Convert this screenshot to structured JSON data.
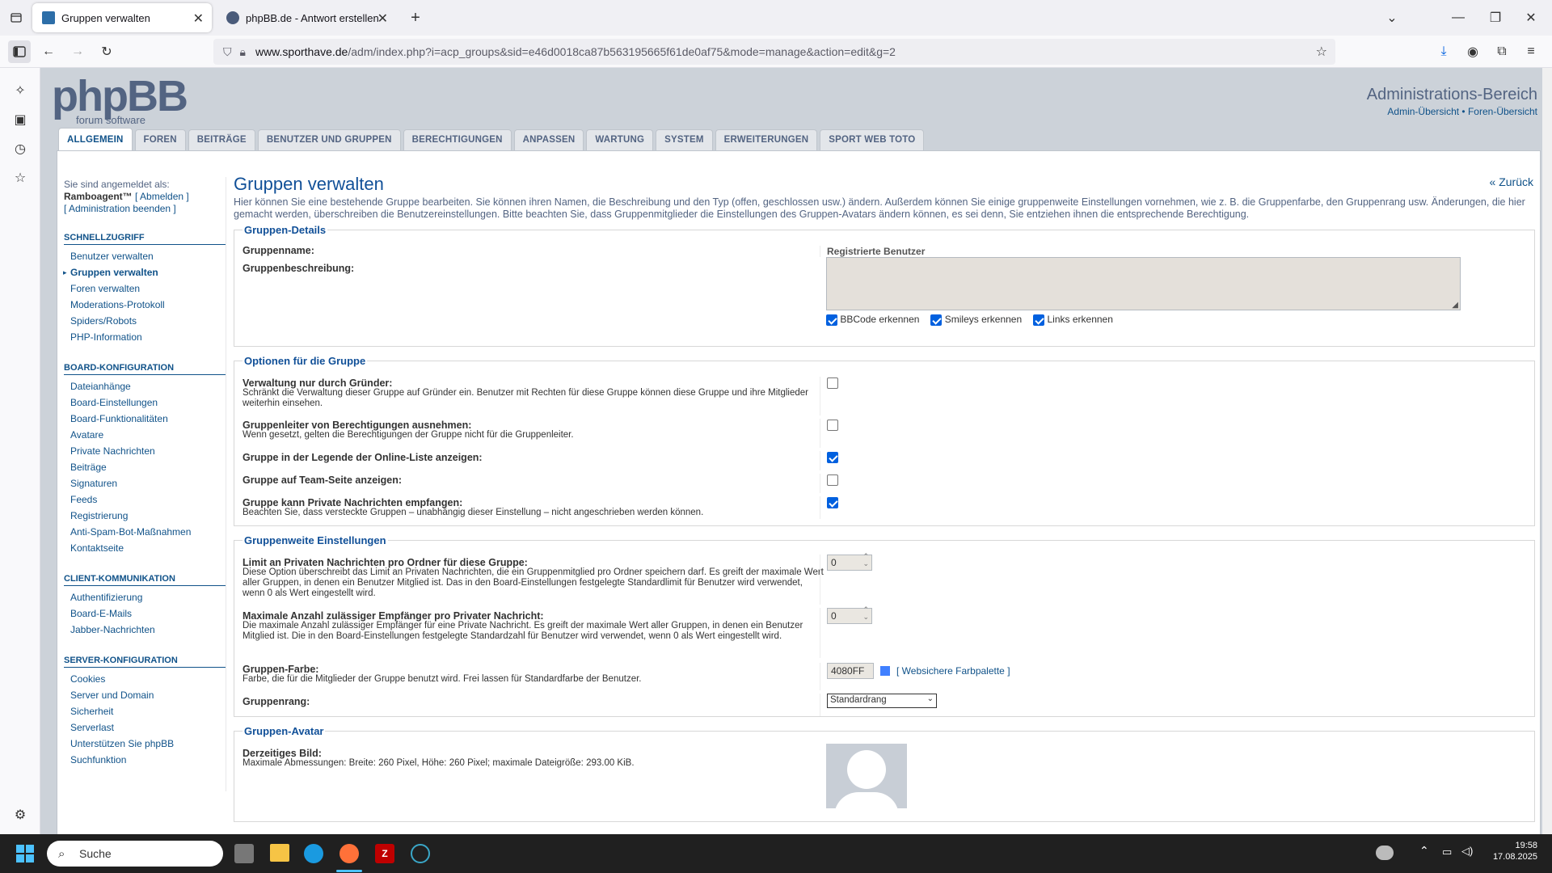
{
  "browser": {
    "tabs": [
      {
        "title": "Gruppen verwalten",
        "active": true
      },
      {
        "title": "phpBB.de - Antwort erstellen",
        "active": false
      }
    ],
    "url_host": "www.sporthave.de",
    "url_path": "/adm/index.php?i=acp_groups&sid=e46d0018ca87b563195665f61de0af75&mode=manage&action=edit&g=2"
  },
  "header": {
    "logo_text": "phpBB",
    "logo_sub": "forum software",
    "admin_title": "Administrations-Bereich",
    "admin_links": "Admin-Übersicht • Foren-Übersicht"
  },
  "tabs": [
    "ALLGEMEIN",
    "FOREN",
    "BEITRÄGE",
    "BENUTZER UND GRUPPEN",
    "BERECHTIGUNGEN",
    "ANPASSEN",
    "WARTUNG",
    "SYSTEM",
    "ERWEITERUNGEN",
    "SPORT WEB TOTO"
  ],
  "menu": {
    "logged_in_label": "Sie sind angemeldet als:",
    "username": "Ramboagent™",
    "logout": "[ Abmelden ]",
    "end_admin": "[ Administration beenden ]",
    "sections": [
      {
        "title": "SCHNELLZUGRIFF",
        "items": [
          "Benutzer verwalten",
          "Gruppen verwalten",
          "Foren verwalten",
          "Moderations-Protokoll",
          "Spiders/Robots",
          "PHP-Information"
        ],
        "active": 1
      },
      {
        "title": "BOARD-KONFIGURATION",
        "items": [
          "Dateianhänge",
          "Board-Einstellungen",
          "Board-Funktionalitäten",
          "Avatare",
          "Private Nachrichten",
          "Beiträge",
          "Signaturen",
          "Feeds",
          "Registrierung",
          "Anti-Spam-Bot-Maßnahmen",
          "Kontaktseite"
        ],
        "active": -1
      },
      {
        "title": "CLIENT-KOMMUNIKATION",
        "items": [
          "Authentifizierung",
          "Board-E-Mails",
          "Jabber-Nachrichten"
        ],
        "active": -1
      },
      {
        "title": "SERVER-KONFIGURATION",
        "items": [
          "Cookies",
          "Server und Domain",
          "Sicherheit",
          "Serverlast",
          "Unterstützen Sie phpBB",
          "Suchfunktion"
        ],
        "active": -1
      }
    ]
  },
  "main": {
    "title": "Gruppen verwalten",
    "back": "« Zurück",
    "intro": "Hier können Sie eine bestehende Gruppe bearbeiten. Sie können ihren Namen, die Beschreibung und den Typ (offen, geschlossen usw.) ändern. Außerdem können Sie einige gruppenweite Einstellungen vornehmen, wie z. B. die Gruppenfarbe, den Gruppenrang usw. Änderungen, die hier gemacht werden, überschreiben die Benutzereinstellungen. Bitte beachten Sie, dass Gruppenmitglieder die Einstellungen des Gruppen-Avatars ändern können, es sei denn, Sie entziehen ihnen die entsprechende Berechtigung.",
    "details": {
      "legend": "Gruppen-Details",
      "name_label": "Gruppenname:",
      "name_value": "Registrierte Benutzer",
      "desc_label": "Gruppenbeschreibung:",
      "bbcode": "BBCode erkennen",
      "smileys": "Smileys erkennen",
      "links": "Links erkennen"
    },
    "options": {
      "legend": "Optionen für die Gruppe",
      "founder_label": "Verwaltung nur durch Gründer:",
      "founder_explain": "Schränkt die Verwaltung dieser Gruppe auf Gründer ein. Benutzer mit Rechten für diese Gruppe können diese Gruppe und ihre Mitglieder weiterhin einsehen.",
      "founder_checked": false,
      "leader_label": "Gruppenleiter von Berechtigungen ausnehmen:",
      "leader_explain": "Wenn gesetzt, gelten die Berechtigungen der Gruppe nicht für die Gruppenleiter.",
      "leader_checked": false,
      "legend_label": "Gruppe in der Legende der Online-Liste anzeigen:",
      "legend_checked": true,
      "team_label": "Gruppe auf Team-Seite anzeigen:",
      "team_checked": false,
      "pm_label": "Gruppe kann Private Nachrichten empfangen:",
      "pm_explain": "Beachten Sie, dass versteckte Gruppen – unabhängig dieser Einstellung – nicht angeschrieben werden können.",
      "pm_checked": true
    },
    "settings": {
      "legend": "Gruppenweite Einstellungen",
      "pm_limit_label": "Limit an Privaten Nachrichten pro Ordner für diese Gruppe:",
      "pm_limit_explain": "Diese Option überschreibt das Limit an Privaten Nachrichten, die ein Gruppenmitglied pro Ordner speichern darf. Es greift der maximale Wert aller Gruppen, in denen ein Benutzer Mitglied ist. Das in den Board-Einstellungen festgelegte Standardlimit für Benutzer wird verwendet, wenn 0 als Wert eingestellt wird.",
      "pm_limit_value": "0",
      "recip_label": "Maximale Anzahl zulässiger Empfänger pro Privater Nachricht:",
      "recip_explain": "Die maximale Anzahl zulässiger Empfänger für eine Private Nachricht. Es greift der maximale Wert aller Gruppen, in denen ein Benutzer Mitglied ist. Die in den Board-Einstellungen festgelegte Standardzahl für Benutzer wird verwendet, wenn 0 als Wert eingestellt wird.",
      "recip_value": "0",
      "color_label": "Gruppen-Farbe:",
      "color_explain": "Farbe, die für die Mitglieder der Gruppe benutzt wird. Frei lassen für Standardfarbe der Benutzer.",
      "color_value": "4080FF",
      "color_swatch": "#4080FF",
      "palette_link": "Websichere Farbpalette",
      "rank_label": "Gruppenrang:",
      "rank_value": "Standardrang"
    },
    "avatar": {
      "legend": "Gruppen-Avatar",
      "current_label": "Derzeitiges Bild:",
      "current_explain": "Maximale Abmessungen: Breite: 260 Pixel, Höhe: 260 Pixel; maximale Dateigröße: 293.00 KiB."
    }
  },
  "taskbar": {
    "search_placeholder": "Suche",
    "time": "19:58",
    "date": "17.08.2025"
  }
}
